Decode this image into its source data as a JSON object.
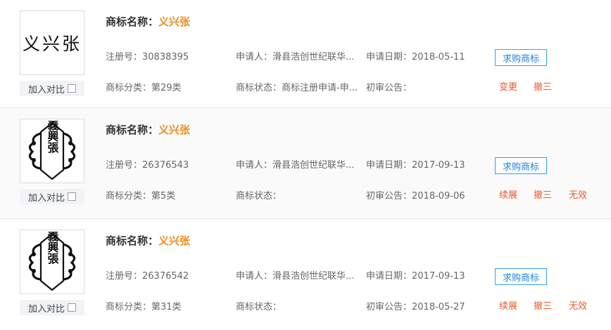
{
  "labels": {
    "name_prefix": "商标名称：",
    "reg_prefix": "注册号：",
    "applicant_prefix": "申请人：",
    "date_prefix": "申请日期：",
    "class_prefix": "商标分类：",
    "status_prefix": "商标状态：",
    "pub_prefix": "初审公告：",
    "compare": "加入对比",
    "buy": "求购商标"
  },
  "results": [
    {
      "logo_text": "义兴张",
      "name": "义兴张",
      "reg_no": "30838395",
      "applicant": "滑县浩创世纪联华...",
      "date": "2018-05-11",
      "class": "第29类",
      "status": "商标注册申请-申...",
      "pub": "",
      "actions": [
        "变更",
        "撤三"
      ]
    },
    {
      "logo_text": "義興張",
      "name": "义兴张",
      "reg_no": "26376543",
      "applicant": "滑县浩创世纪联华...",
      "date": "2017-09-13",
      "class": "第5类",
      "status": "",
      "pub": "2018-09-06",
      "actions": [
        "续展",
        "撤三",
        "无效"
      ]
    },
    {
      "logo_text": "義興張",
      "name": "义兴张",
      "reg_no": "26376542",
      "applicant": "滑县浩创世纪联华...",
      "date": "2017-09-13",
      "class": "第31类",
      "status": "",
      "pub": "2018-05-27",
      "actions": [
        "续展",
        "撤三",
        "无效"
      ]
    }
  ],
  "colors": {
    "accent_orange": "#f08a1d",
    "action_red": "#e85a2a",
    "button_blue": "#1f83d6"
  }
}
